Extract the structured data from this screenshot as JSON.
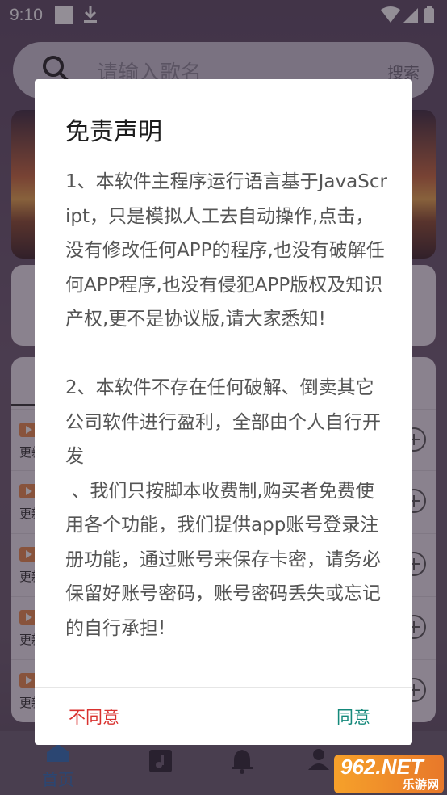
{
  "status_bar": {
    "time": "9:10"
  },
  "search": {
    "placeholder": "请输入歌名",
    "button": "搜索"
  },
  "list": {
    "rows": [
      {
        "label": "更新"
      },
      {
        "label": "更新"
      },
      {
        "label": "更新"
      },
      {
        "label": "更新"
      },
      {
        "label": "更新"
      }
    ]
  },
  "bottom_nav": {
    "items": [
      {
        "label": "首页",
        "icon": "home-icon",
        "active": true
      },
      {
        "label": "",
        "icon": "music-library-icon"
      },
      {
        "label": "",
        "icon": "bell-icon"
      },
      {
        "label": "",
        "icon": "user-icon"
      }
    ],
    "active_color": "#2f6fb6"
  },
  "dialog": {
    "title": "免责声明",
    "body": "1、本软件主程序运行语言基于JavaScript，只是模拟人工去自动操作,点击，没有修改任何APP的程序,也没有破解任何APP程序,也没有侵犯APP版权及知识产权,更不是协议版,请大家悉知!\n\n2、本软件不存在任何破解、倒卖其它公司软件进行盈利，全部由个人自行开发\n 、我们只按脚本收费制,购买者免费使用各个功能，我们提供app账号登录注册功能，通过账号来保存卡密，请务必保留好账号密码，账号密码丢失或忘记的自行承担!",
    "disagree": "不同意",
    "agree": "同意",
    "disagree_color": "#d9322f",
    "agree_color": "#15897b"
  },
  "watermark": {
    "brand": "962.NET",
    "subtitle": "乐游网"
  }
}
